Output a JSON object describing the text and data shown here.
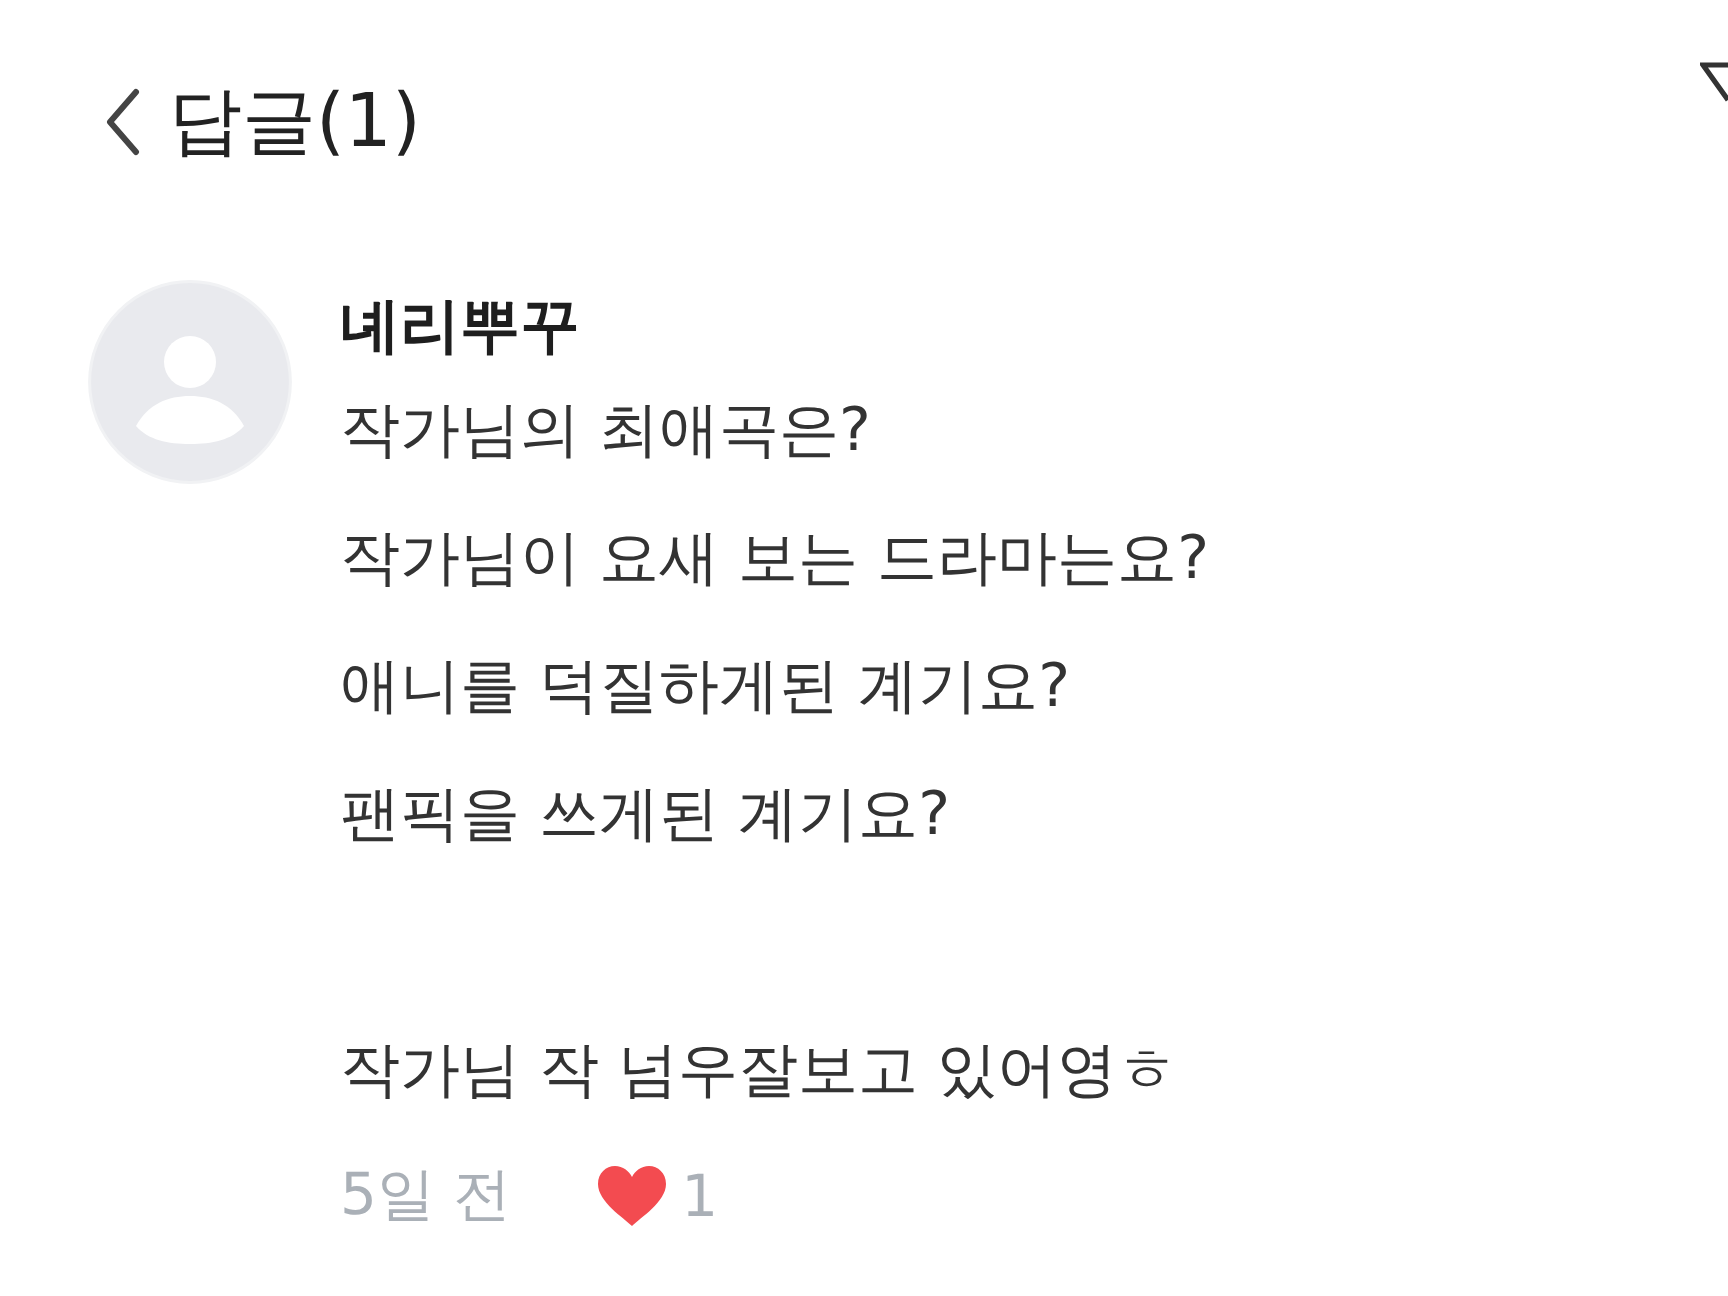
{
  "header": {
    "title": "답글(1)"
  },
  "comment": {
    "author": "녜리뿌꾸",
    "body": "작가님의 최애곡은?\n작가님이 요새 보는 드라마는요?\n애니를 덕질하게된 계기요?\n팬픽을 쓰게된 계기요?\n\n작가님 작 넘우잘보고 있어영ㅎ",
    "time": "5일 전",
    "liked": true,
    "like_count": "1"
  }
}
